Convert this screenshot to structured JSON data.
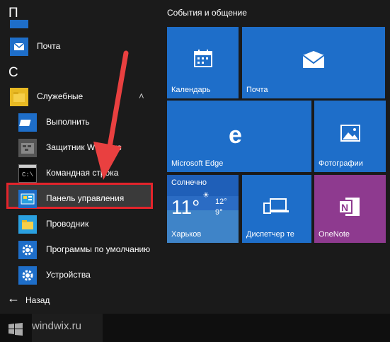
{
  "start_menu": {
    "letters": {
      "p": "П",
      "s": "С"
    },
    "apps": [
      {
        "label": "Почта"
      },
      {
        "label": "Служебные"
      },
      {
        "label": "Выполнить"
      },
      {
        "label": "Защитник Windows"
      },
      {
        "label": "Командная строка"
      },
      {
        "label": "Панель управления"
      },
      {
        "label": "Проводник"
      },
      {
        "label": "Программы по умолчанию"
      },
      {
        "label": "Устройства"
      }
    ],
    "back_label": "Назад"
  },
  "tiles": {
    "group_title": "События и общение",
    "calendar": "Календарь",
    "mail": "Почта",
    "edge": "Microsoft Edge",
    "photos": "Фотографии",
    "weather": {
      "condition": "Солнечно",
      "temp": "11°",
      "high": "12°",
      "low": "9°",
      "city": "Харьков"
    },
    "device_manager": "Диспетчер те",
    "onenote": "OneNote"
  },
  "taskbar": {
    "watermark": "windwix.ru"
  },
  "colors": {
    "accent": "#1e6ec9",
    "highlight_border": "#e3242b",
    "onenote": "#8e3a8f",
    "arrow": "#e94040"
  }
}
